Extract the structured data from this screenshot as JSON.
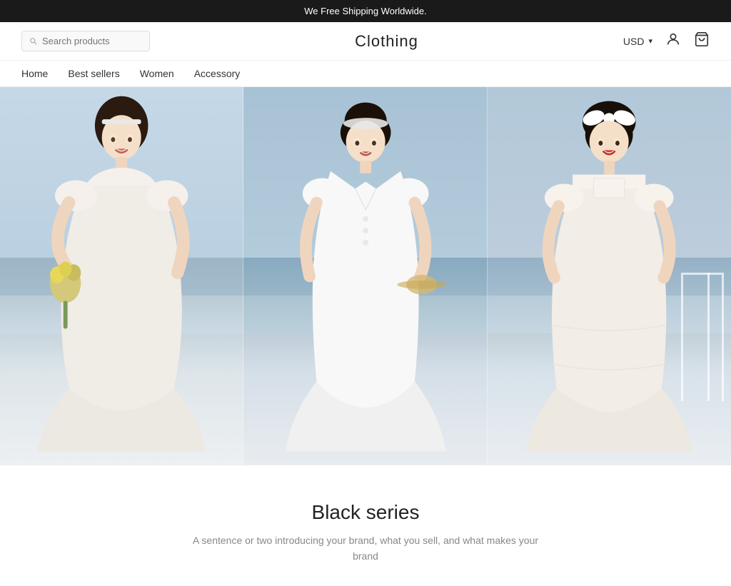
{
  "banner": {
    "text": "We Free Shipping Worldwide."
  },
  "header": {
    "search_placeholder": "Search products",
    "logo": "Clothing",
    "currency": "USD",
    "currency_arrow": "▾"
  },
  "nav": {
    "items": [
      {
        "label": "Home",
        "id": "home"
      },
      {
        "label": "Best sellers",
        "id": "best-sellers"
      },
      {
        "label": "Women",
        "id": "women"
      },
      {
        "label": "Accessory",
        "id": "accessory"
      }
    ]
  },
  "hero": {
    "alt": "Fashion models in white dresses"
  },
  "section": {
    "title": "Black series",
    "subtitle": "A sentence or two introducing your brand, what you sell, and what makes your brand"
  },
  "icons": {
    "search": "🔍",
    "user": "👤",
    "cart": "🛒"
  }
}
